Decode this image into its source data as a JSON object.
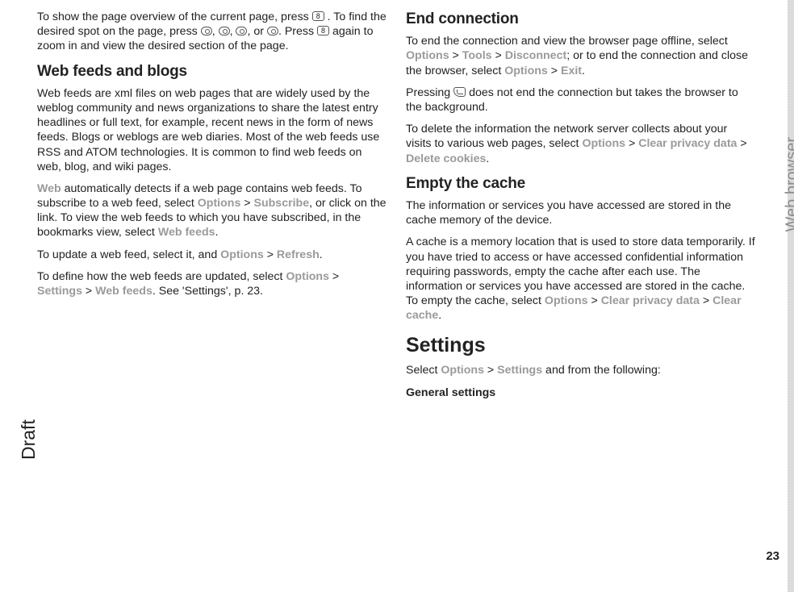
{
  "left": {
    "p1_a": "To show the page overview of the current page, press ",
    "p1_key1": "8",
    "p1_b": ". To find the desired spot on the page, press ",
    "p1_c": ", ",
    "p1_d": ", ",
    "p1_e": ", or ",
    "p1_f": ". Press ",
    "p1_key2": "8",
    "p1_g": " again to zoom in and view the desired section of the page.",
    "h1": "Web feeds and blogs",
    "p2": "Web feeds are xml files on web pages that are widely used by the weblog community and news organizations to share the latest entry headlines or full text, for example, recent news in the form of news feeds. Blogs or weblogs are web diaries. Most of the web feeds use RSS and ATOM technologies. It is common to find web feeds on web, blog, and wiki pages.",
    "p3_ref1": "Web",
    "p3_a": " automatically detects if a web page contains web feeds. To subscribe to a web feed, select ",
    "p3_ref2": "Options",
    "p3_gt1": " > ",
    "p3_ref3": "Subscribe",
    "p3_b": ", or click on the link. To view the web feeds to which you have subscribed, in the bookmarks view, select ",
    "p3_ref4": "Web feeds",
    "p3_c": ".",
    "p4_a": "To update a web feed, select it, and ",
    "p4_ref1": "Options",
    "p4_gt": " > ",
    "p4_ref2": "Refresh",
    "p4_b": ".",
    "p5_a": "To define how the web feeds are updated, select ",
    "p5_ref1": "Options",
    "p5_gt1": " > ",
    "p5_ref2": "Settings",
    "p5_gt2": " > ",
    "p5_ref3": "Web feeds",
    "p5_b": ". See 'Settings', p. 23."
  },
  "right": {
    "h1": "End connection",
    "p1_a": "To end the connection and view the browser page offline, select ",
    "p1_ref1": "Options",
    "p1_gt1": " > ",
    "p1_ref2": "Tools",
    "p1_gt2": " > ",
    "p1_ref3": "Disconnect",
    "p1_b": "; or to end the connection and close the browser, select ",
    "p1_ref4": "Options",
    "p1_gt3": " > ",
    "p1_ref5": "Exit",
    "p1_c": ".",
    "p2_a": "Pressing ",
    "p2_b": " does not end the connection but takes the browser to the background.",
    "p3_a": "To delete the information the network server collects about your visits to various web pages, select ",
    "p3_ref1": "Options",
    "p3_gt1": " > ",
    "p3_ref2": "Clear privacy data",
    "p3_gt2": " > ",
    "p3_ref3": "Delete cookies",
    "p3_b": ".",
    "h2": "Empty the cache",
    "p4": "The information or services you have accessed are stored in the cache memory of the device.",
    "p5_a": "A cache is a memory location that is used to store data temporarily. If you have tried to access or have accessed confidential information requiring passwords, empty the cache after each use. The information or services you have accessed are stored in the cache. To empty the cache, select ",
    "p5_ref1": "Options",
    "p5_gt1": " > ",
    "p5_ref2": "Clear privacy data",
    "p5_gt2": " > ",
    "p5_ref3": "Clear cache",
    "p5_b": ".",
    "h3": "Settings",
    "p6_a": "Select ",
    "p6_ref1": "Options",
    "p6_gt": " > ",
    "p6_ref2": "Settings",
    "p6_b": " and from the following:",
    "p7": "General settings"
  },
  "margin": {
    "draft": "Draft",
    "section": "Web browser",
    "page": "23"
  }
}
